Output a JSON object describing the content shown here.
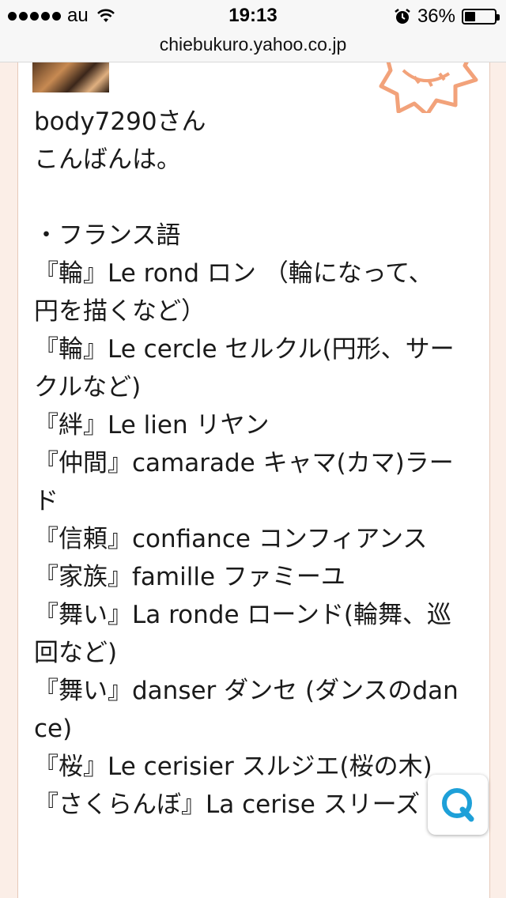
{
  "status_bar": {
    "carrier": "au",
    "time": "19:13",
    "battery_percent": "36%",
    "battery_level": 0.36
  },
  "browser": {
    "url": "chiebukuro.yahoo.co.jp"
  },
  "answer": {
    "lines": [
      "body7290さん",
      "こんばんは。",
      "",
      "・フランス語",
      "『輪』Le rond ロン （輪になって、",
      "円を描くなど）",
      "『輪』Le cercle セルクル(円形、サー",
      "クルなど)",
      "『絆』Le lien リヤン",
      "『仲間』camarade キャマ(カマ)ラー",
      "ド",
      "『信頼』confiance コンフィアンス",
      "『家族』famille ファミーユ",
      "『舞い』La ronde ローンド(輪舞、巡",
      "回など)",
      "『舞い』danser ダンセ (ダンスのdan",
      "ce)",
      "『桜』Le cerisier スルジエ(桜の木)",
      "『さくらんぼ』La cerise スリーズ"
    ]
  },
  "icons": {
    "signal": "signal-dots-icon",
    "wifi": "wifi-icon",
    "alarm": "alarm-clock-icon",
    "battery": "battery-icon",
    "search": "search-q-icon",
    "badge": "stamp-badge-icon"
  },
  "colors": {
    "page_background": "#fbeee7",
    "card_border": "#e6c9b9",
    "badge_orange": "#f2a27a",
    "search_blue": "#1ea0d8"
  }
}
